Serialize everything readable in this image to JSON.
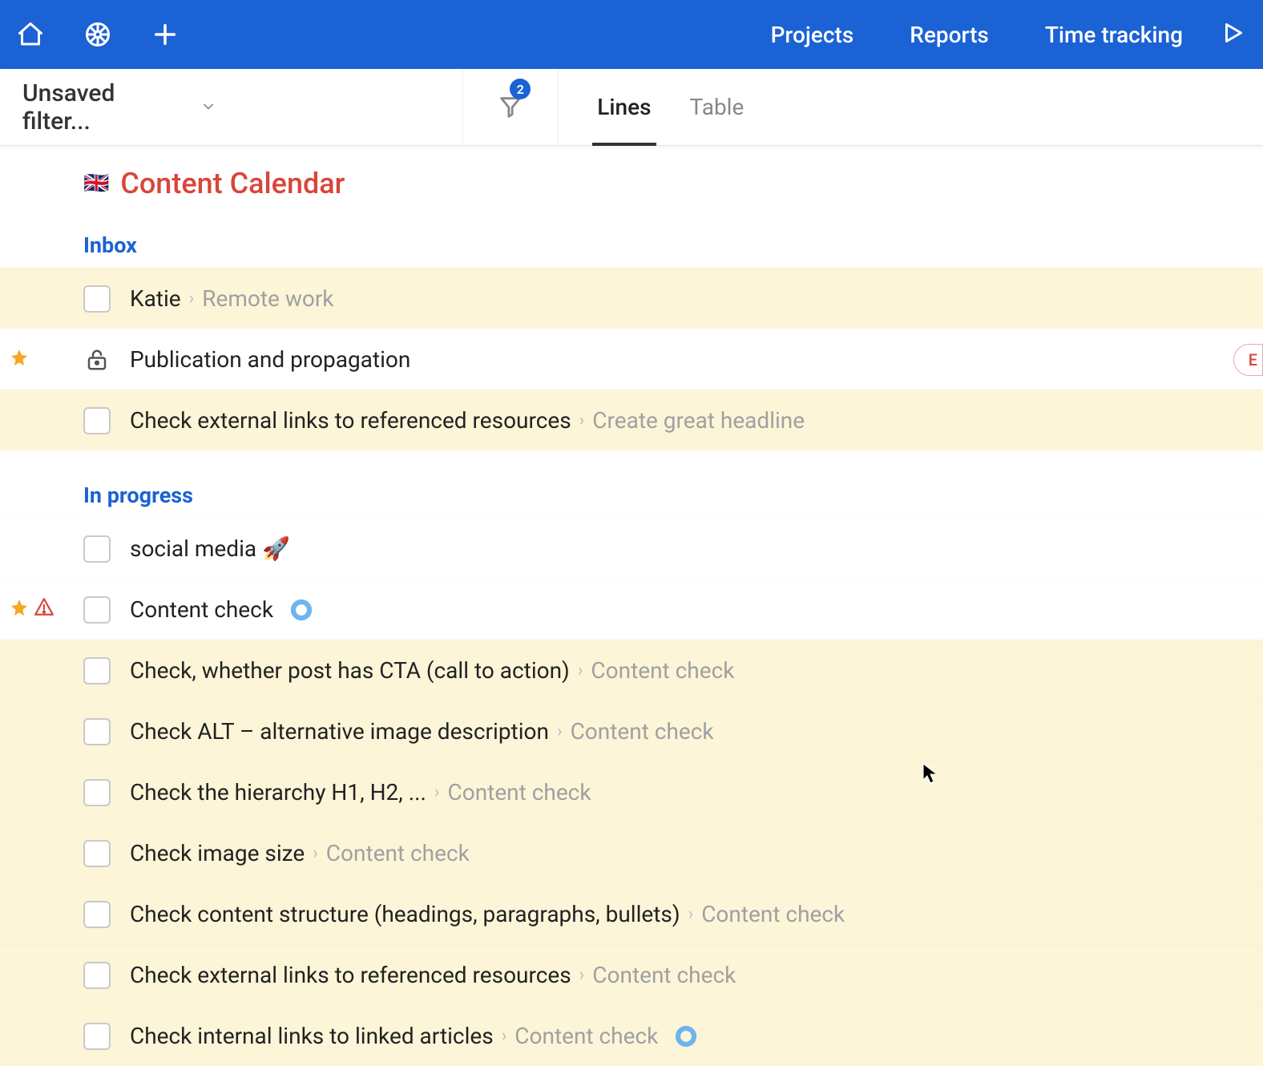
{
  "topnav": {
    "items": [
      "Projects",
      "Reports",
      "Time tracking"
    ]
  },
  "filter": {
    "label": "Unsaved filter...",
    "badge": "2"
  },
  "viewtabs": {
    "active": "Lines",
    "tabs": [
      "Lines",
      "Table"
    ]
  },
  "page": {
    "flag": "🇬🇧",
    "title": "Content Calendar"
  },
  "sections": {
    "inbox": {
      "header": "Inbox",
      "rows": [
        {
          "label": "Katie",
          "crumb": "Remote work",
          "highlight": true,
          "checkbox": true
        },
        {
          "label": "Publication and propagation",
          "lock": true,
          "star": true,
          "badge": "E"
        },
        {
          "label": "Check external links to referenced resources",
          "crumb": "Create great headline",
          "highlight": true,
          "checkbox": true
        }
      ]
    },
    "in_progress": {
      "header": "In progress",
      "rows": [
        {
          "label": "social media 🚀",
          "checkbox": true
        },
        {
          "label": "Content check",
          "checkbox": true,
          "star": true,
          "warning": true,
          "ring": true
        },
        {
          "label": "Check, whether post has CTA (call to action)",
          "crumb": "Content check",
          "highlight": true,
          "checkbox": true
        },
        {
          "label": "Check ALT – alternative image description",
          "crumb": "Content check",
          "highlight": true,
          "checkbox": true
        },
        {
          "label": "Check the hierarchy H1, H2, ...",
          "crumb": "Content check",
          "highlight": true,
          "checkbox": true
        },
        {
          "label": "Check image size",
          "crumb": "Content check",
          "highlight": true,
          "checkbox": true
        },
        {
          "label": "Check content structure (headings, paragraphs, bullets)",
          "crumb": "Content check",
          "highlight": true,
          "checkbox": true
        },
        {
          "label": "Check external links to referenced resources",
          "crumb": "Content check",
          "highlight": true,
          "checkbox": true
        },
        {
          "label": "Check internal links to linked articles",
          "crumb": "Content check",
          "highlight": true,
          "checkbox": true,
          "ring": true
        }
      ]
    }
  }
}
